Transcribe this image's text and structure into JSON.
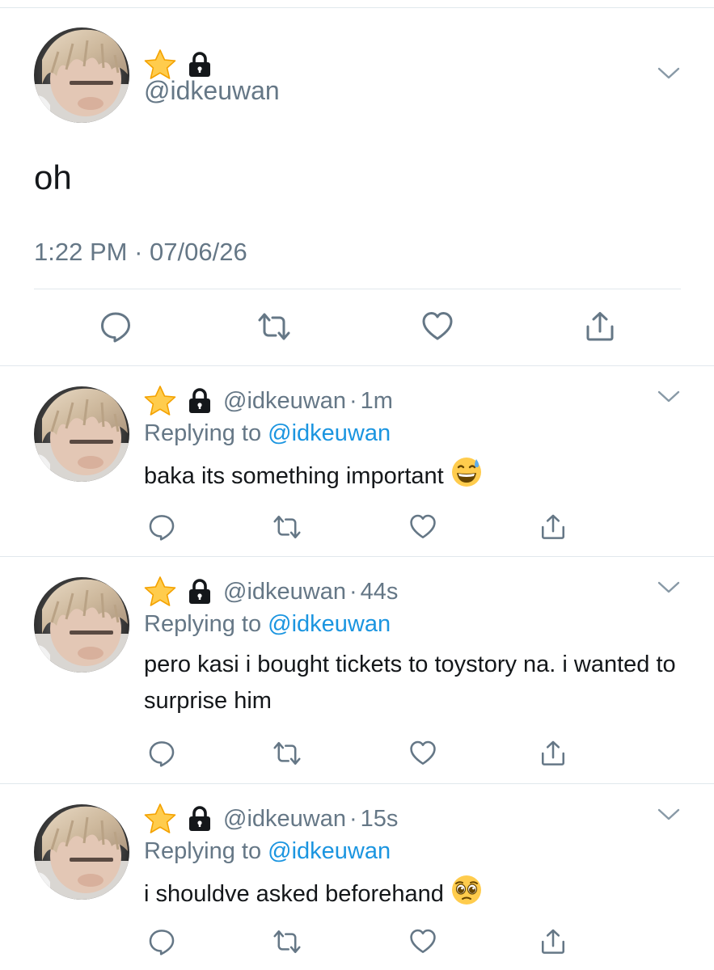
{
  "main_tweet": {
    "handle": "@idkeuwan",
    "text": "oh",
    "time": "1:22 PM",
    "dot": "·",
    "date": "07/06/26",
    "icons": [
      "star-icon",
      "lock-icon",
      "chevron-down-icon",
      "reply-icon",
      "retweet-icon",
      "like-icon",
      "share-icon"
    ]
  },
  "replies": [
    {
      "handle": "@idkeuwan",
      "dot": "·",
      "age": "1m",
      "replying_prefix": "Replying to ",
      "replying_to": "@idkeuwan",
      "text": "baka its something important",
      "emoji": "grinning-face-with-sweat"
    },
    {
      "handle": "@idkeuwan",
      "dot": "·",
      "age": "44s",
      "replying_prefix": "Replying to ",
      "replying_to": "@idkeuwan",
      "text": "pero kasi i bought tickets to toystory na. i wanted to surprise him",
      "emoji": ""
    },
    {
      "handle": "@idkeuwan",
      "dot": "·",
      "age": "15s",
      "replying_prefix": "Replying to ",
      "replying_to": "@idkeuwan",
      "text": "i shouldve asked beforehand",
      "emoji": "pleading-face"
    }
  ],
  "colors": {
    "text": "#14171a",
    "secondary": "#657786",
    "link": "#1b95e0",
    "divider": "#e1e8ed",
    "star": "#ffcc4d"
  }
}
